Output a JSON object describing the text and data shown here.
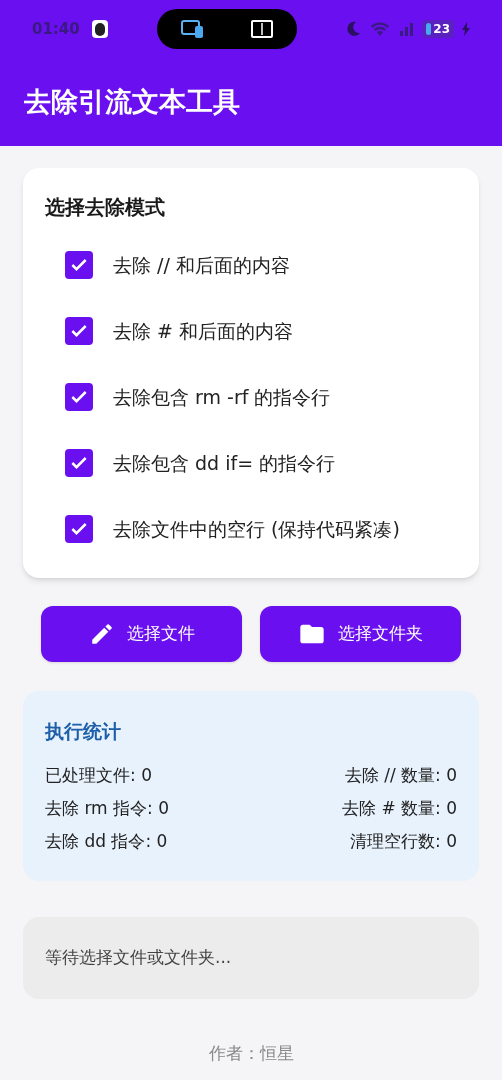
{
  "status_bar": {
    "time": "01:40",
    "battery": "23"
  },
  "app_bar": {
    "title": "去除引流文本工具"
  },
  "mode_card": {
    "title": "选择去除模式",
    "options": [
      {
        "label": "去除 // 和后面的内容",
        "checked": true
      },
      {
        "label": "去除 # 和后面的内容",
        "checked": true
      },
      {
        "label": "去除包含 rm -rf 的指令行",
        "checked": true
      },
      {
        "label": "去除包含 dd if= 的指令行",
        "checked": true
      },
      {
        "label": "去除文件中的空行 (保持代码紧凑)",
        "checked": true
      }
    ]
  },
  "buttons": [
    {
      "kind": "file",
      "label": "选择文件"
    },
    {
      "kind": "folder",
      "label": "选择文件夹"
    }
  ],
  "stats": {
    "title": "执行统计",
    "rows": [
      {
        "left": "已处理文件: 0",
        "right": "去除 // 数量: 0"
      },
      {
        "left": "去除 rm 指令: 0",
        "right": "去除 # 数量: 0"
      },
      {
        "left": "去除 dd 指令: 0",
        "right": "清理空行数: 0"
      }
    ]
  },
  "log": {
    "text": "等待选择文件或文件夹..."
  },
  "footer": "作者：恒星"
}
